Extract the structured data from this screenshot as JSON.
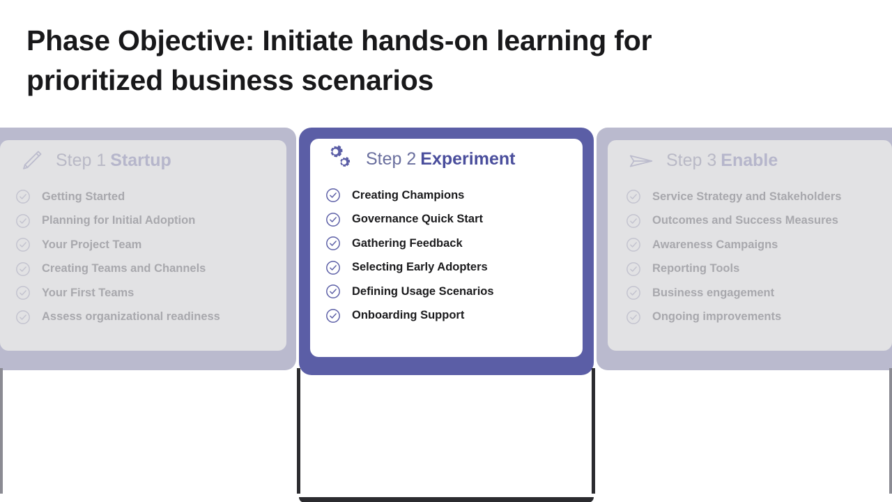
{
  "slide": {
    "title": "Phase Objective: Initiate hands-on learning for prioritized business scenarios"
  },
  "colors": {
    "active_frame": "#5b5ea6",
    "active_accent": "#4a4e9c",
    "dim_frame": "#babace",
    "dim_panel": "#e2e2e4",
    "dim_text": "#a8a8ad",
    "title_text": "#18181a",
    "shadow": "#2b2b2f"
  },
  "cards": [
    {
      "id": "card-1",
      "state": "inactive",
      "icon": "pencil-icon",
      "step_label": "Step 1",
      "name_label": "Startup",
      "items": [
        "Getting Started",
        "Planning for Initial Adoption",
        "Your Project Team",
        "Creating Teams and Channels",
        "Your First Teams",
        "Assess organizational readiness"
      ]
    },
    {
      "id": "card-2",
      "state": "active",
      "icon": "gears-icon",
      "step_label": "Step 2",
      "name_label": "Experiment",
      "items": [
        "Creating Champions",
        "Governance Quick Start",
        "Gathering Feedback",
        "Selecting Early Adopters",
        "Defining Usage Scenarios",
        "Onboarding Support"
      ]
    },
    {
      "id": "card-3",
      "state": "inactive",
      "icon": "paper-plane-icon",
      "step_label": "Step 3",
      "name_label": "Enable",
      "items": [
        "Service Strategy and Stakeholders",
        "Outcomes and Success Measures",
        "Awareness Campaigns",
        "Reporting Tools",
        "Business engagement",
        "Ongoing improvements"
      ]
    }
  ]
}
